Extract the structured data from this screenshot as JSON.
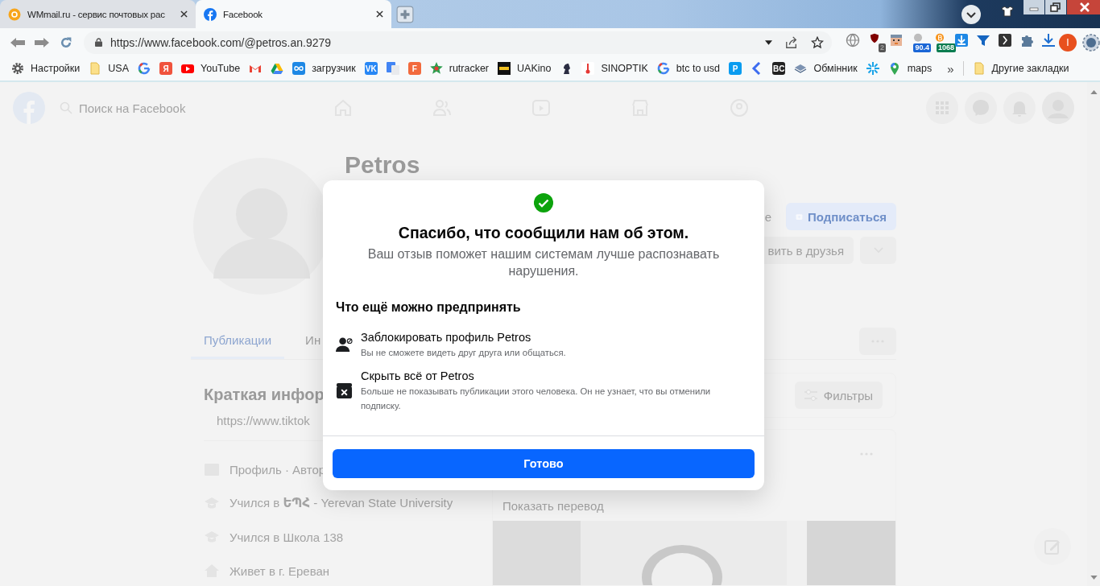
{
  "browser": {
    "tabs": [
      {
        "title": "WMmail.ru - сервис почтовых рас",
        "kind": "mail",
        "selected": false
      },
      {
        "title": "Facebook",
        "kind": "facebook",
        "selected": true
      }
    ],
    "address": "https://www.facebook.com/@petros.an.9279",
    "extensions": [
      {
        "kind": "globe"
      },
      {
        "kind": "shield",
        "badge": "2"
      },
      {
        "kind": "face"
      },
      {
        "kind": "coin",
        "badge": "90.4"
      },
      {
        "kind": "bitcoin",
        "badge": "1068"
      },
      {
        "kind": "download-box"
      },
      {
        "kind": "funnel"
      },
      {
        "kind": "bracket"
      },
      {
        "kind": "puzzle"
      },
      {
        "kind": "download"
      }
    ],
    "profile_initial": "I",
    "bookmarks": [
      {
        "kind": "gear",
        "label": "Настройки"
      },
      {
        "kind": "folder",
        "label": "USA"
      },
      {
        "kind": "google"
      },
      {
        "kind": "letter",
        "glyph": "Я",
        "color": "#f0533d"
      },
      {
        "kind": "youtube",
        "label": "YouTube"
      },
      {
        "kind": "gmail"
      },
      {
        "kind": "drive"
      },
      {
        "kind": "infinity",
        "label": "загрузчик"
      },
      {
        "kind": "letter",
        "glyph": "VK",
        "color": "#2787f5"
      },
      {
        "kind": "translate"
      },
      {
        "kind": "letter",
        "glyph": "F",
        "color": "#f26a3d"
      },
      {
        "kind": "star",
        "label": "rutracker"
      },
      {
        "kind": "film",
        "label": "UAKino"
      },
      {
        "kind": "knight"
      },
      {
        "kind": "thermometer",
        "label": "SINOPTIK"
      },
      {
        "kind": "google",
        "label": "btc to usd"
      },
      {
        "kind": "letter",
        "glyph": "P",
        "color": "#0a9cf0"
      },
      {
        "kind": "chevron"
      },
      {
        "kind": "letter",
        "glyph": "BC",
        "color": "#222222"
      },
      {
        "kind": "stack",
        "label": "Обмінник"
      },
      {
        "kind": "spark"
      },
      {
        "kind": "pin",
        "label": "maps"
      }
    ],
    "more": "»",
    "other_bookmarks": "Другие закладки"
  },
  "facebook": {
    "search_placeholder": "Поиск на Facebook",
    "profile_name": "Petros",
    "partial_button": "е",
    "subscribe": "Подписаться",
    "add_friend": "вить в друзья",
    "tabs": [
      "Публикации",
      "Ин"
    ],
    "intro_title": "Краткая инфор",
    "intro_link": "https://www.tiktok",
    "intro_rows": [
      {
        "kind": "page",
        "text": "Профиль · Автор"
      },
      {
        "kind": "school",
        "text": "Учился в **ԵՊՀ** - Yerevan State University"
      },
      {
        "kind": "school",
        "text": "Учился в Школа 138"
      },
      {
        "kind": "home",
        "text": "Живет в г. Ереван"
      }
    ],
    "filters": "Фильтры",
    "translate_link": "Показать перевод"
  },
  "dialog": {
    "title": "Спасибо, что сообщили нам об этом.",
    "subtitle": "Ваш отзыв поможет нашим системам лучше распознавать нарушения.",
    "section": "Что ещё можно предпринять",
    "options": [
      {
        "kind": "block",
        "title": "Заблокировать профиль Petros",
        "description": "Вы не сможете видеть друг друга или общаться."
      },
      {
        "kind": "hide",
        "title": "Скрыть всё от Petros",
        "description": "Больше не показывать публикации этого человека. Он не узнает, что вы отменили подписку."
      }
    ],
    "button": "Готово"
  }
}
